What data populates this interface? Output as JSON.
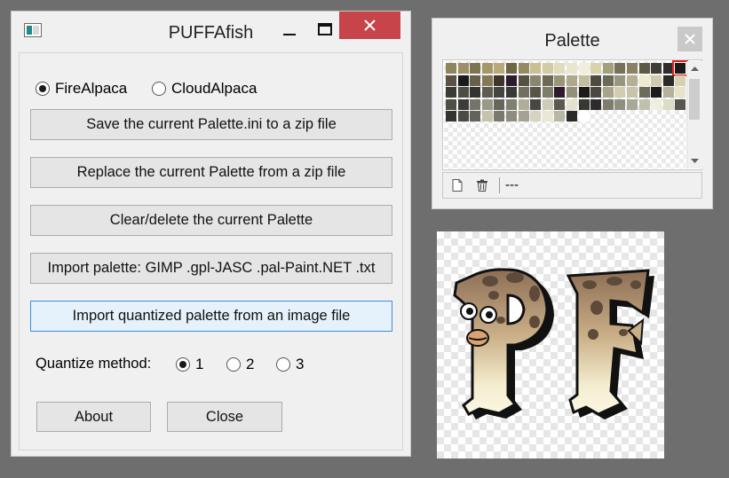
{
  "main_window": {
    "title": "PUFFAfish",
    "app_options": [
      {
        "label": "FireAlpaca",
        "selected": true
      },
      {
        "label": "CloudAlpaca",
        "selected": false
      }
    ],
    "buttons": {
      "save_zip": "Save the current Palette.ini to a zip file",
      "replace_zip": "Replace the current Palette from a zip file",
      "clear": "Clear/delete the current Palette",
      "import_palette": "Import palette: GIMP .gpl-JASC .pal-Paint.NET .txt",
      "import_quantized": "Import quantized palette from an image file",
      "about": "About",
      "close": "Close"
    },
    "quantize": {
      "label": "Quantize method:",
      "options": [
        {
          "label": "1",
          "selected": true
        },
        {
          "label": "2",
          "selected": false
        },
        {
          "label": "3",
          "selected": false
        }
      ]
    }
  },
  "palette_window": {
    "title": "Palette",
    "status": "---",
    "icons": {
      "new": "new-page-icon",
      "delete": "trash-icon"
    },
    "selected_swatch": 19,
    "swatches": [
      "#8e8460",
      "#9d9064",
      "#7e7452",
      "#a49868",
      "#baa978",
      "#6f6646",
      "#958b63",
      "#c9bf93",
      "#d3cba3",
      "#e2dcbe",
      "#eae6cd",
      "#f1eedd",
      "#d9d2ad",
      "#a3a07b",
      "#777159",
      "#8a8262",
      "#5c5a47",
      "#3e3e36",
      "#2e2d2a",
      "#1a1a18",
      "#5a5242",
      "#1a1a1a",
      "#675f4b",
      "#847a5a",
      "#3f352b",
      "#2d1b2d",
      "#565241",
      "#8a8570",
      "#6e6a55",
      "#9b9577",
      "#aea98a",
      "#c2bd9c",
      "#4e4c3f",
      "#6b6a58",
      "#999680",
      "#b4b096",
      "#eeeccf",
      "#cfcab0",
      "#2a2a26",
      "#d5d0b0",
      "#3b3b35",
      "#4e4d43",
      "#333330",
      "#5f5d4f",
      "#454440",
      "#3a3834",
      "#707062",
      "#585446",
      "#7f7d6b",
      "#2d1a2d",
      "#928f7b",
      "#1b1b19",
      "#4a4840",
      "#a7a38c",
      "#d2cdb2",
      "#c8c4ac",
      "#6d6b5d",
      "#1c1c1c",
      "#b5b19a",
      "#e6e3c8",
      "#504f45",
      "#3c3c38",
      "#76746a",
      "#9a9888",
      "#686658",
      "#808070",
      "#b0ae9b",
      "#484842",
      "#cfccb6",
      "#5a594f",
      "#e4e2cd",
      "#373734",
      "#2c2c2a",
      "#7e7c6e",
      "#918f7f",
      "#a9a797",
      "#c1bfae",
      "#f0eedc",
      "#dddbc8",
      "#575650",
      "#33332f",
      "#4b4a44",
      "#64635a",
      "#c6c3ad",
      "#7a796d",
      "#8f8d80",
      "#a4a294",
      "#d6d4c0",
      "#e9e7d5",
      "#b8b6a5",
      "#2a2a28",
      "#ffffff"
    ]
  }
}
